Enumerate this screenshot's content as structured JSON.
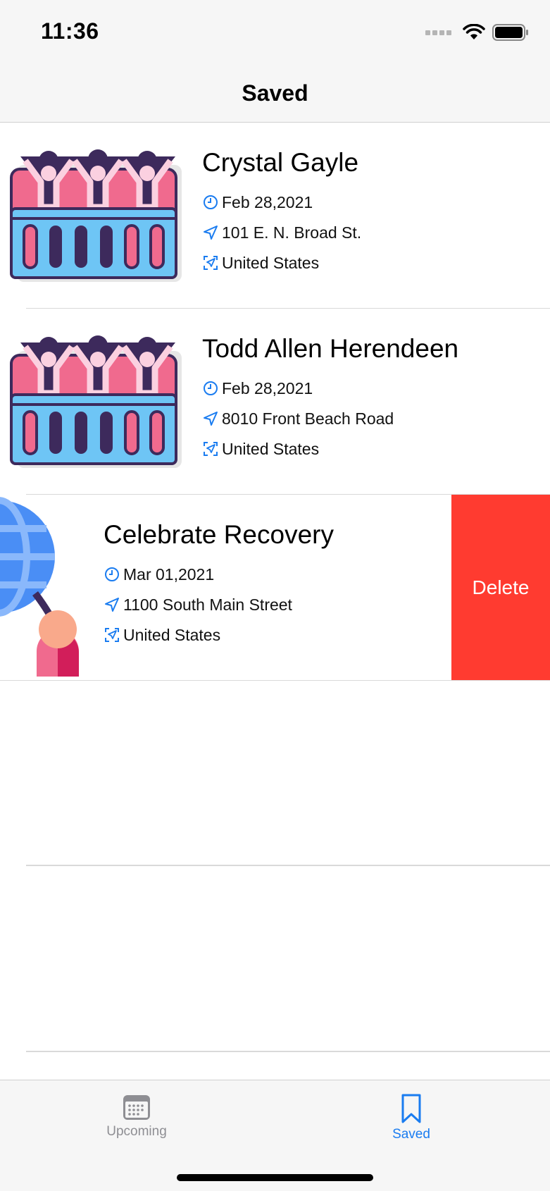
{
  "status_bar": {
    "time": "11:36"
  },
  "nav": {
    "title": "Saved"
  },
  "events": [
    {
      "title": "Crystal Gayle",
      "date": "Feb 28,2021",
      "address": "101 E. N. Broad St.",
      "country": "United States",
      "icon": "concert-crowd-icon"
    },
    {
      "title": "Todd Allen Herendeen",
      "date": "Feb 28,2021",
      "address": "8010 Front Beach Road",
      "country": "United States",
      "icon": "concert-crowd-icon"
    },
    {
      "title": "Celebrate Recovery",
      "date": "Mar 01,2021",
      "address": "1100 South Main Street",
      "country": "United States",
      "icon": "globe-person-icon"
    }
  ],
  "actions": {
    "delete_label": "Delete"
  },
  "tabs": [
    {
      "label": "Upcoming",
      "icon": "calendar-icon",
      "active": false
    },
    {
      "label": "Saved",
      "icon": "bookmark-icon",
      "active": true
    }
  ],
  "colors": {
    "accent": "#1a7cf0",
    "delete": "#ff3b30",
    "inactive": "#8e8e93"
  }
}
